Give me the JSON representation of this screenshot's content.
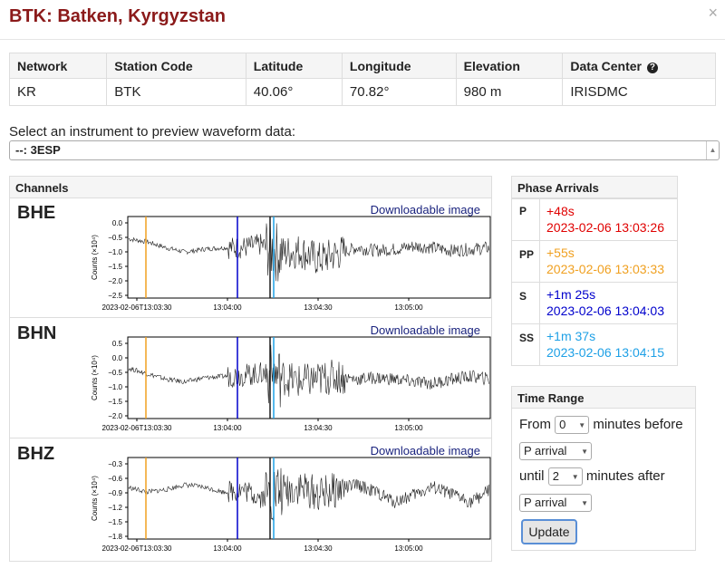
{
  "modal": {
    "title": "BTK: Batken, Kyrgyzstan",
    "close": "×"
  },
  "station_table": {
    "headers": [
      "Network",
      "Station Code",
      "Latitude",
      "Longitude",
      "Elevation",
      "Data Center"
    ],
    "row": [
      "KR",
      "BTK",
      "40.06°",
      "70.82°",
      "980 m",
      "IRISDMC"
    ],
    "help_icon": "question-circle-icon"
  },
  "instrument": {
    "label": "Select an instrument to preview waveform data:",
    "selected": "--: 3ESP"
  },
  "channels": {
    "heading": "Channels",
    "download_label": "Downloadable image",
    "ylabel": "Counts (×10⁴)",
    "xticks": [
      "2023-02-06T13:03:30",
      "13:04:00",
      "13:04:30",
      "13:05:00"
    ],
    "items": [
      {
        "name": "BHE",
        "yticks": [
          "0.0",
          "−0.5",
          "−1.0",
          "−1.5",
          "−2.0",
          "−2.5"
        ]
      },
      {
        "name": "BHN",
        "yticks": [
          "0.5",
          "0.0",
          "−0.5",
          "−1.0",
          "−1.5",
          "−2.0"
        ]
      },
      {
        "name": "BHZ",
        "yticks": [
          "−0.3",
          "−0.6",
          "−0.9",
          "−1.2",
          "−1.5",
          "−1.8"
        ]
      }
    ]
  },
  "chart_data": [
    {
      "type": "line",
      "title": "BHE",
      "ylabel": "Counts (×10⁴)",
      "ylim": [
        -2.5,
        0.25
      ],
      "xticks": [
        "2023-02-06T13:03:30",
        "13:04:00",
        "13:04:30",
        "13:05:00"
      ],
      "series": [
        {
          "values": [
            -0.5,
            -0.6,
            -0.8,
            -0.95,
            -0.85,
            -0.8,
            -0.8,
            -0.7,
            -1.0,
            -0.9,
            -1.2,
            -1.0,
            -0.8,
            -0.9,
            -0.85,
            -0.75,
            -0.8,
            -0.9,
            -0.85,
            -0.8
          ]
        }
      ]
    },
    {
      "type": "line",
      "title": "BHN",
      "ylabel": "Counts (×10⁴)",
      "ylim": [
        -2.3,
        0.6
      ],
      "xticks": [
        "2023-02-06T13:03:30",
        "13:04:00",
        "13:04:30",
        "13:05:00"
      ],
      "series": [
        {
          "values": [
            -0.5,
            -0.7,
            -0.9,
            -1.0,
            -0.85,
            -0.8,
            -0.75,
            -0.7,
            -0.8,
            -1.0,
            -0.9,
            -0.8,
            -0.9,
            -0.85,
            -0.9,
            -1.0,
            -1.05,
            -0.9,
            -0.8,
            -0.9
          ]
        }
      ]
    },
    {
      "type": "line",
      "title": "BHZ",
      "ylabel": "Counts (×10⁴)",
      "ylim": [
        -1.85,
        -0.2
      ],
      "xticks": [
        "2023-02-06T13:03:30",
        "13:04:00",
        "13:04:30",
        "13:05:00"
      ],
      "series": [
        {
          "values": [
            -0.8,
            -0.9,
            -0.85,
            -0.75,
            -0.8,
            -0.9,
            -0.85,
            -1.0,
            -0.9,
            -0.8,
            -0.95,
            -0.85,
            -0.75,
            -0.9,
            -1.1,
            -0.95,
            -0.8,
            -0.95,
            -1.1,
            -0.85
          ]
        }
      ]
    }
  ],
  "phase_arrivals": {
    "heading": "Phase Arrivals",
    "phases": [
      {
        "name": "P",
        "relative": "+48s",
        "absolute": "2023-02-06 13:03:26",
        "color": "#e00000"
      },
      {
        "name": "PP",
        "relative": "+55s",
        "absolute": "2023-02-06 13:03:33",
        "color": "#f0a020"
      },
      {
        "name": "S",
        "relative": "+1m 25s",
        "absolute": "2023-02-06 13:04:03",
        "color": "#0000cc"
      },
      {
        "name": "SS",
        "relative": "+1m 37s",
        "absolute": "2023-02-06 13:04:15",
        "color": "#1ea0e6"
      }
    ]
  },
  "time_range": {
    "heading": "Time Range",
    "from_label": "From",
    "from_value": "0",
    "before_label": "minutes before",
    "before_phase": "P arrival",
    "until_label": "until",
    "until_value": "2",
    "after_label": "minutes after",
    "after_phase": "P arrival",
    "update_label": "Update"
  }
}
